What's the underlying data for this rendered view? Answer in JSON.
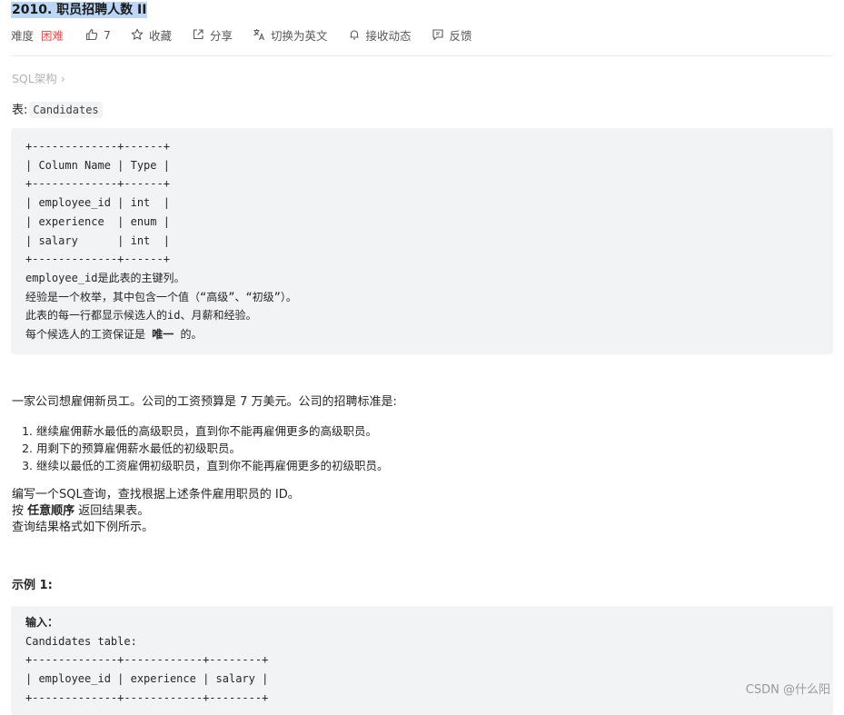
{
  "header": {
    "title": "2010. 职员招聘人数 II",
    "difficulty_label": "难度",
    "difficulty": "困难",
    "likes": "7",
    "favorite": "收藏",
    "share": "分享",
    "switch_lang": "切换为英文",
    "subscribe": "接收动态",
    "feedback": "反馈"
  },
  "breadcrumb": "SQL架构 ›",
  "table_intro": {
    "label": "表:",
    "name": "Candidates"
  },
  "schema_code": "+-------------+------+\n| Column Name | Type |\n+-------------+------+\n| employee_id | int  |\n| experience  | enum |\n| salary      | int  |\n+-------------+------+",
  "schema_notes": {
    "line1": "employee_id是此表的主键列。",
    "line2": "经验是一个枚举，其中包含一个值（“高级”、“初级”）。",
    "line3": "此表的每一行都显示候选人的id、月薪和经验。",
    "line4_pre": "每个候选人的工资保证是 ",
    "line4_strong": "唯一",
    "line4_post": " 的。"
  },
  "description": {
    "intro": "一家公司想雇佣新员工。公司的工资预算是 7 万美元。公司的招聘标准是:",
    "rules": [
      "继续雇佣薪水最低的高级职员，直到你不能再雇佣更多的高级职员。",
      "用剩下的预算雇佣薪水最低的初级职员。",
      "继续以最低的工资雇佣初级职员，直到你不能再雇佣更多的初级职员。"
    ],
    "task": "编写一个SQL查询，查找根据上述条件雇用职员的 ID。",
    "order_pre": "按 ",
    "order_strong": "任意顺序",
    "order_post": " 返回结果表。",
    "format": "查询结果格式如下例所示。"
  },
  "example": {
    "heading": "示例 1:",
    "input_label": "输入：",
    "code": "Candidates table:\n+-------------+------------+--------+\n| employee_id | experience | salary |\n+-------------+------------+--------+"
  },
  "watermark": "CSDN @什么阳"
}
